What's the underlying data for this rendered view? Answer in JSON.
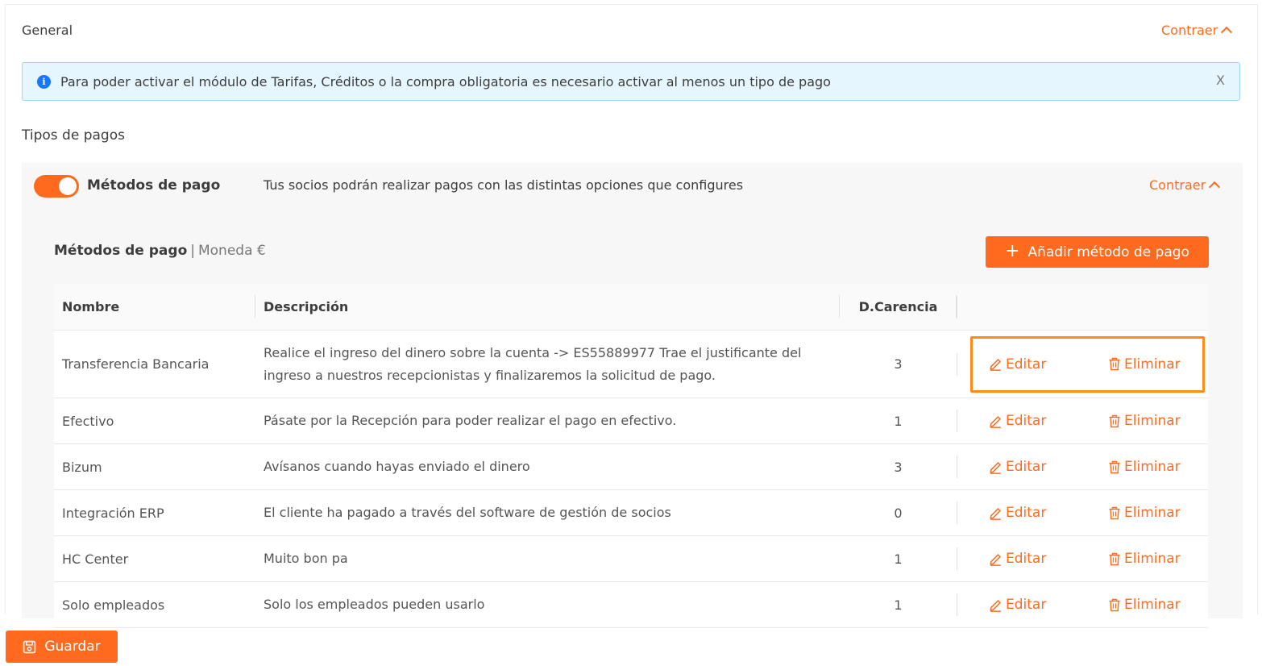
{
  "section": {
    "title": "General",
    "collapse_label": "Contraer"
  },
  "alert": {
    "message": "Para poder activar el módulo de Tarifas, Créditos o la compra obligatoria es necesario activar al menos un tipo de pago",
    "close_label": "X"
  },
  "subtitle": "Tipos de pagos",
  "panel": {
    "toggle_on": true,
    "toggle_label": "Métodos de pago",
    "description": "Tus socios podrán realizar pagos con las distintas opciones que configures",
    "collapse_label": "Contraer",
    "methods_title": "Métodos de pago",
    "separator": "|",
    "currency": "Moneda €",
    "add_button": "Añadir método de pago"
  },
  "table": {
    "headers": [
      "Nombre",
      "Descripción",
      "D.Carencia",
      ""
    ],
    "edit_label": "Editar",
    "delete_label": "Eliminar",
    "rows": [
      {
        "name": "Transferencia Bancaria",
        "description": "Realice el ingreso del dinero sobre la cuenta -> ES55889977 Trae el justificante del ingreso a nuestros recepcionistas y finalizaremos la solicitud de pago.",
        "carencia": "3"
      },
      {
        "name": "Efectivo",
        "description": "Pásate por la Recepción para poder realizar el pago en efectivo.",
        "carencia": "1"
      },
      {
        "name": "Bizum",
        "description": "Avísanos cuando hayas enviado el dinero",
        "carencia": "3"
      },
      {
        "name": "Integración ERP",
        "description": "El cliente ha pagado a través del software de gestión de socios",
        "carencia": "0"
      },
      {
        "name": "HC Center",
        "description": "Muito bon pa",
        "carencia": "1"
      },
      {
        "name": "Solo empleados",
        "description": "Solo los empleados pueden usarlo",
        "carencia": "1"
      }
    ]
  },
  "save_button": "Guardar",
  "colors": {
    "accent": "#ff6a1f",
    "highlight": "#ff8c1a",
    "alert_bg": "#e6f6fe",
    "info_icon": "#1677ff"
  }
}
